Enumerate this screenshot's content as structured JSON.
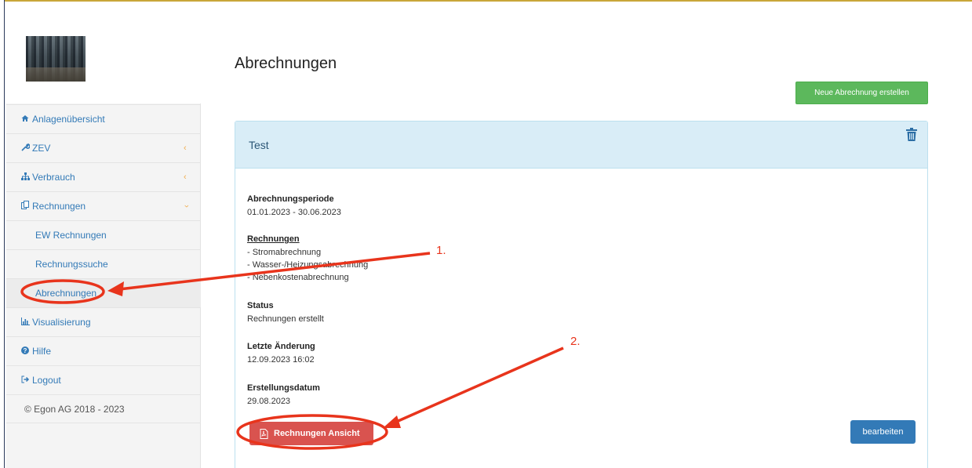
{
  "sidebar": {
    "items": [
      {
        "label": "Anlagenübersicht",
        "icon": "home-icon"
      },
      {
        "label": "ZEV",
        "icon": "wrench-icon"
      },
      {
        "label": "Verbrauch",
        "icon": "sitemap-icon"
      },
      {
        "label": "Rechnungen",
        "icon": "copy-icon"
      },
      {
        "label": "EW Rechnungen"
      },
      {
        "label": "Rechnungssuche"
      },
      {
        "label": "Abrechnungen"
      },
      {
        "label": "Visualisierung",
        "icon": "bar-chart-icon"
      },
      {
        "label": "Hilfe",
        "icon": "question-circle-icon"
      },
      {
        "label": "Logout",
        "icon": "sign-out-icon"
      }
    ],
    "copyright": "© Egon AG 2018 - 2023"
  },
  "main": {
    "title": "Abrechnungen",
    "new_button": "Neue Abrechnung erstellen",
    "panel": {
      "title": "Test",
      "period_label": "Abrechnungsperiode",
      "period_value": "01.01.2023 - 30.06.2023",
      "invoices_label": "Rechnungen",
      "invoices": [
        "- Stromabrechnung",
        "- Wasser-/Heizungsabrechnung",
        "- Nebenkostenabrechnung"
      ],
      "status_label": "Status",
      "status_value": "Rechnungen erstellt",
      "changed_label": "Letzte Änderung",
      "changed_value": "12.09.2023 16:02",
      "created_label": "Erstellungsdatum",
      "created_value": "29.08.2023",
      "view_button": "Rechnungen Ansicht",
      "edit_button": "bearbeiten"
    }
  },
  "annotations": {
    "step1": "1.",
    "step2": "2."
  },
  "colors": {
    "accent_green": "#5cb85c",
    "accent_blue": "#337ab7",
    "accent_red": "#d9534f",
    "annotation_red": "#e8341c",
    "panel_header": "#d9edf7"
  }
}
